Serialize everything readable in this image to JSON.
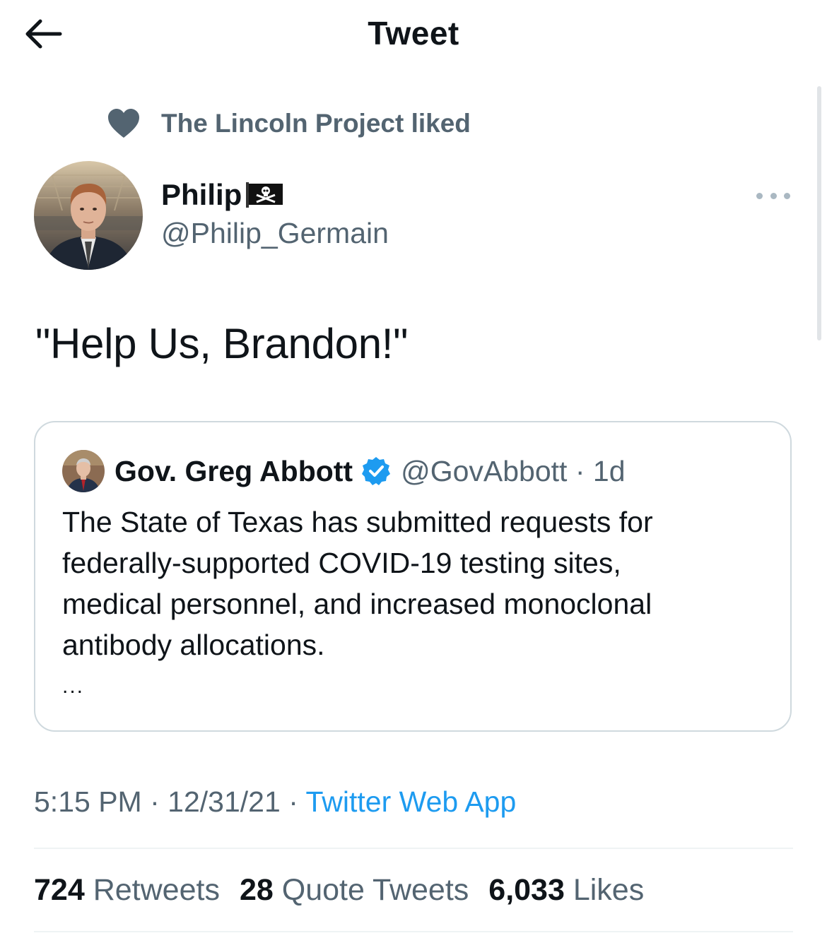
{
  "header": {
    "title": "Tweet",
    "back_icon": "arrow-left-icon"
  },
  "social_context": {
    "icon": "heart-icon",
    "text": "The Lincoln Project liked"
  },
  "author": {
    "name": "Philip",
    "emoji": "pirate-flag-icon",
    "handle": "@Philip_Germain"
  },
  "tweet": {
    "text": "\"Help Us, Brandon!\"",
    "time": "5:15 PM",
    "date": "12/31/21",
    "separator": "·",
    "source": "Twitter Web App"
  },
  "quoted_tweet": {
    "name": "Gov. Greg Abbott",
    "verified_icon": "verified-badge-icon",
    "handle": "@GovAbbott",
    "age": "1d",
    "lines": [
      "The State of Texas has submitted requests for",
      "federally-supported COVID-19 testing sites,",
      "medical personnel, and increased monoclonal",
      "antibody allocations."
    ],
    "ellipsis": "..."
  },
  "stats": {
    "retweets_count": "724",
    "retweets_label": "Retweets",
    "quotes_count": "28",
    "quotes_label": "Quote Tweets",
    "likes_count": "6,033",
    "likes_label": "Likes"
  },
  "colors": {
    "accent": "#1d9bf0",
    "secondary_text": "#536471",
    "primary_text": "#0f1419",
    "border": "#cfd9de"
  }
}
